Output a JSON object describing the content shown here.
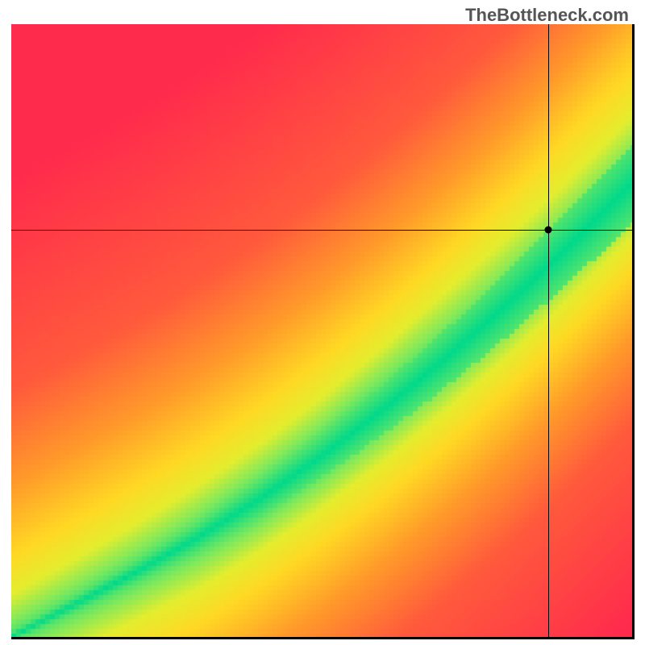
{
  "watermark": "TheBottleneck.com",
  "chart_data": {
    "type": "heatmap",
    "title": "",
    "xlabel": "",
    "ylabel": "",
    "xrange": [
      0,
      1
    ],
    "yrange": [
      0,
      1
    ],
    "marker": {
      "x": 0.865,
      "y": 0.665
    },
    "crosshair": {
      "x": 0.865,
      "y": 0.665
    },
    "series_curve": {
      "description": "Optimal balance ridge (green band centerline), y as function of x",
      "points": [
        {
          "x": 0.0,
          "y": 0.0
        },
        {
          "x": 0.1,
          "y": 0.052
        },
        {
          "x": 0.2,
          "y": 0.105
        },
        {
          "x": 0.3,
          "y": 0.162
        },
        {
          "x": 0.4,
          "y": 0.225
        },
        {
          "x": 0.5,
          "y": 0.295
        },
        {
          "x": 0.6,
          "y": 0.372
        },
        {
          "x": 0.7,
          "y": 0.455
        },
        {
          "x": 0.8,
          "y": 0.544
        },
        {
          "x": 0.9,
          "y": 0.639
        },
        {
          "x": 1.0,
          "y": 0.74
        }
      ]
    },
    "band_halfwidth": {
      "description": "Approximate vertical half-width of green band as function of x",
      "points": [
        {
          "x": 0.0,
          "w": 0.008
        },
        {
          "x": 0.25,
          "w": 0.02
        },
        {
          "x": 0.5,
          "w": 0.035
        },
        {
          "x": 0.75,
          "w": 0.05
        },
        {
          "x": 1.0,
          "w": 0.065
        }
      ]
    },
    "colorscale": {
      "description": "Distance-from-ridge mapped to color",
      "stops": [
        {
          "d": 0.0,
          "color": "#00D98B"
        },
        {
          "d": 0.06,
          "color": "#7FE95C"
        },
        {
          "d": 0.12,
          "color": "#E4ED2E"
        },
        {
          "d": 0.2,
          "color": "#FFD824"
        },
        {
          "d": 0.35,
          "color": "#FF9A2A"
        },
        {
          "d": 0.55,
          "color": "#FF5A3C"
        },
        {
          "d": 1.0,
          "color": "#FF2B4C"
        }
      ]
    }
  }
}
